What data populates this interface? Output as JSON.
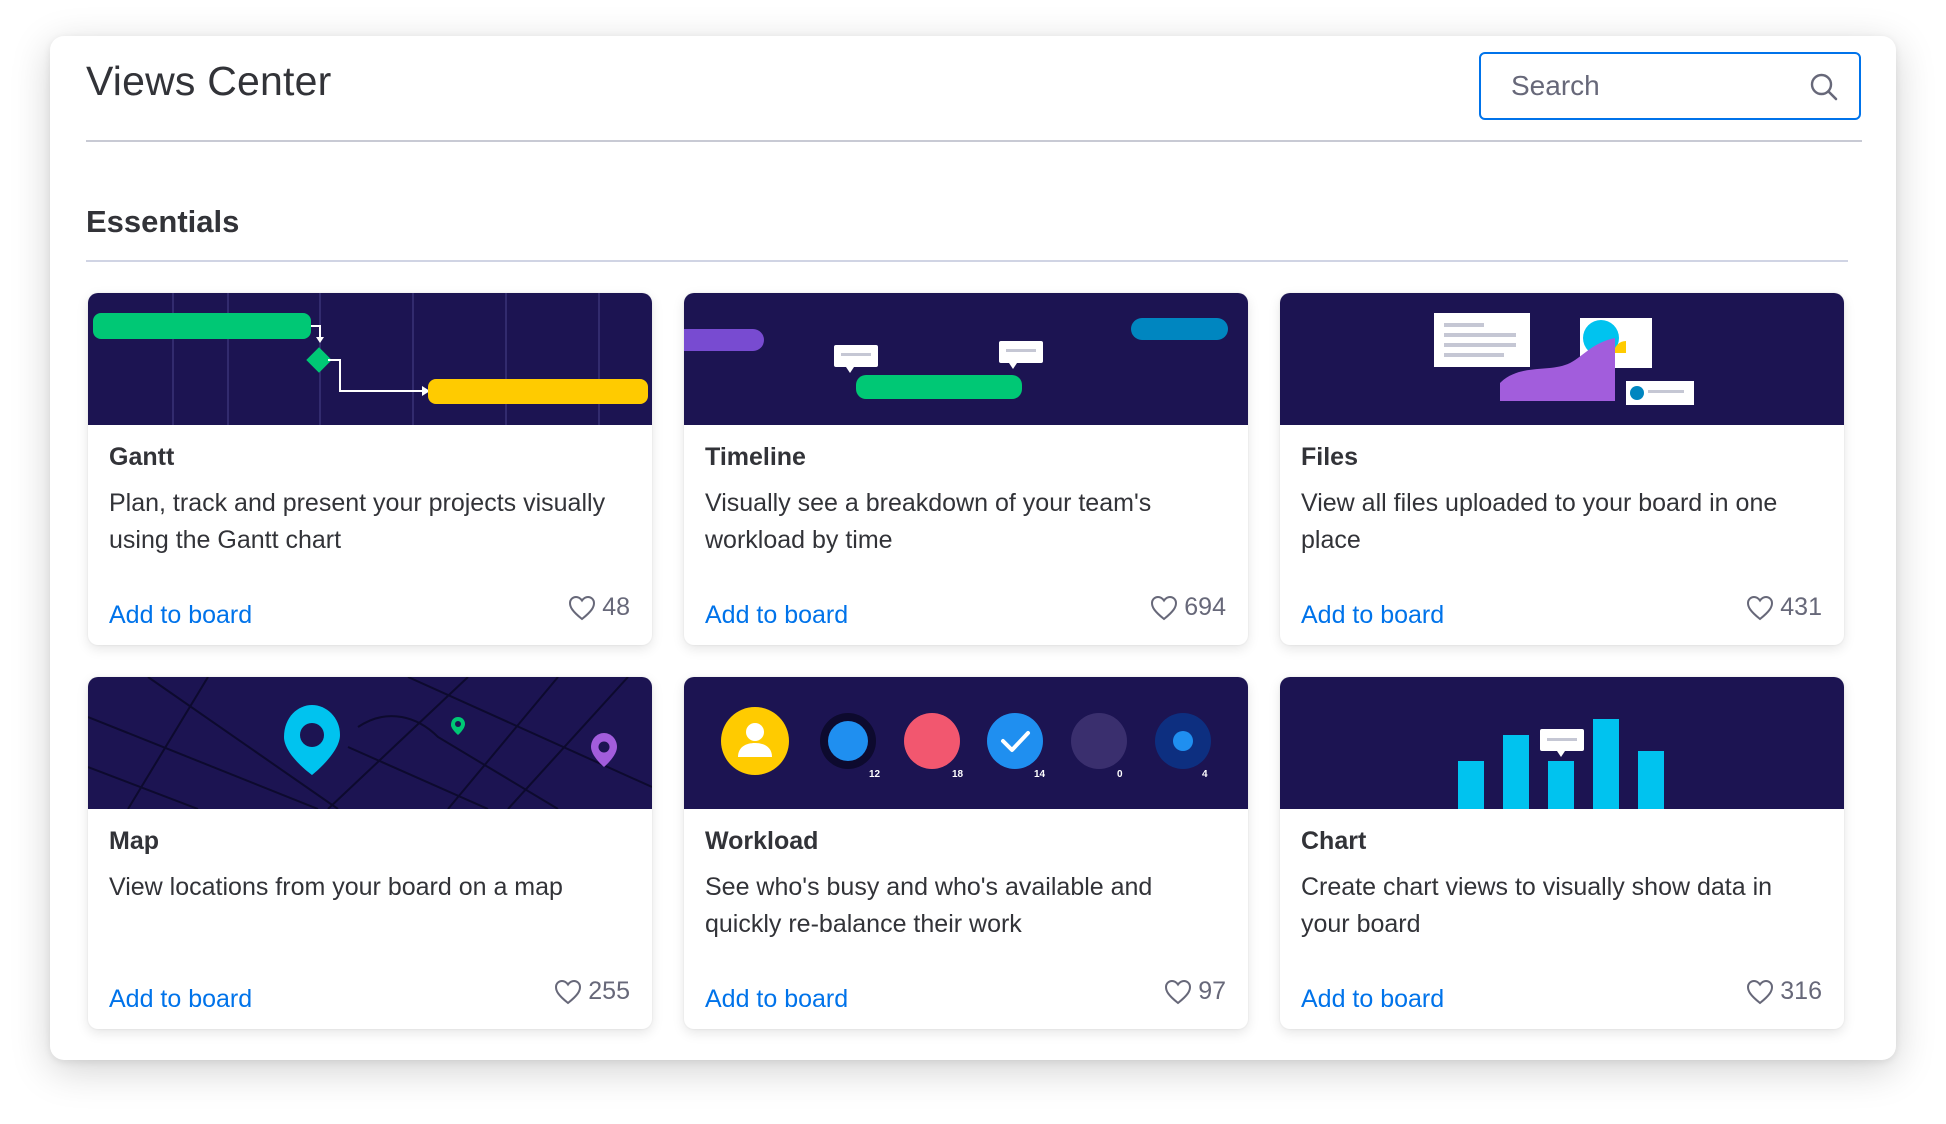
{
  "header": {
    "title": "Views Center",
    "search_placeholder": "Search"
  },
  "section": {
    "title": "Essentials"
  },
  "cards": [
    {
      "title": "Gantt",
      "description": "Plan, track and present your projects visually using the Gantt chart",
      "action": "Add to board",
      "likes": "48",
      "icon": "gantt-illustration"
    },
    {
      "title": "Timeline",
      "description": "Visually see a breakdown of your team's workload by time",
      "action": "Add to board",
      "likes": "694",
      "icon": "timeline-illustration"
    },
    {
      "title": "Files",
      "description": "View all files uploaded to your board in one place",
      "action": "Add to board",
      "likes": "431",
      "icon": "files-illustration"
    },
    {
      "title": "Map",
      "description": "View locations from your board on a map",
      "action": "Add to board",
      "likes": "255",
      "icon": "map-illustration"
    },
    {
      "title": "Workload",
      "description": "See who's busy and who's available and quickly re-balance their work",
      "action": "Add to board",
      "likes": "97",
      "icon": "workload-illustration",
      "counts": [
        "12",
        "18",
        "14",
        "0",
        "4"
      ]
    },
    {
      "title": "Chart",
      "description": "Create chart views to visually show data in your board",
      "action": "Add to board",
      "likes": "316",
      "icon": "chart-illustration"
    }
  ],
  "colors": {
    "banner": "#1c1452",
    "accent": "#0073ea",
    "green": "#00c875",
    "yellow": "#ffcb00",
    "purple": "#a25ddc",
    "cyan": "#00c3ef",
    "pink": "#f2576f"
  }
}
